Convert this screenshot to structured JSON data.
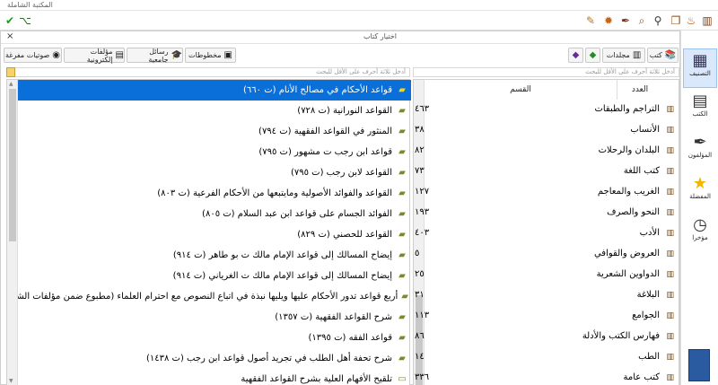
{
  "window": {
    "title": "المكتبة الشاملة",
    "toolbar_icons": [
      "books-icon",
      "book-open-icon",
      "fire-icon",
      "search-icon",
      "search-doc-icon",
      "quill-icon",
      "gear-icon",
      "edit-icon"
    ],
    "left_icons": [
      "check-icon",
      "tree-icon"
    ]
  },
  "subwindow": {
    "title": "اختيار كتاب",
    "close": "×"
  },
  "tabs": {
    "books": "كتب",
    "volumes": "مجلدات",
    "manuscripts": "مخطوطات",
    "theses": "رسائل جامعية",
    "ebooks": "مؤلفات إلكترونية",
    "audio": "صوتيات مفرغة"
  },
  "filters": {
    "books_placeholder": "أدخل ثلاثة أحرف على الأقل للبحث",
    "categories_placeholder": "أدخل ثلاثة أحرف على الأقل للبحث"
  },
  "columns": {
    "category": "القسم",
    "count": "العدد"
  },
  "books": [
    "قواعد الأحكام في مصالح الأنام (ت ٦٦٠)",
    "القواعد النورانية (ت ٧٢٨)",
    "المنثور في القواعد الفقهية (ت ٧٩٤)",
    "قواعد ابن رجب ت مشهور (ت ٧٩٥)",
    "القواعد لابن رجب (ت ٧٩٥)",
    "القواعد والفوائد الأصولية ومايتبعها من الأحكام الفرعية (ت ٨٠٣)",
    "الفوائد الجسام على قواعد ابن عبد السلام (ت ٨٠٥)",
    "القواعد للحصني (ت ٨٢٩)",
    "إيضاح المسالك إلى قواعد الإمام مالك ت بو طاهر (ت ٩١٤)",
    "إيضاح المسالك إلى قواعد الإمام مالك ت الغرياني (ت ٩١٤)",
    "أربع قواعد تدور الأحكام عليها ويليها نبذة في اتباع النصوص مع احترام العلماء (مطبوع ضمن مؤلفات الشيخ محمد بن...",
    "شرح القواعد الفقهية (ت ١٣٥٧)",
    "قواعد الفقه (ت ١٣٩٥)",
    "شرح تحفة أهل الطلب في تجريد أصول قواعد ابن رجب (ت ١٤٣٨)",
    "تلقيح الأفهام العلية بشرح القواعد الفقهية"
  ],
  "categories": [
    {
      "name": "التراجم والطبقات",
      "count": "٤٦٣"
    },
    {
      "name": "الأنساب",
      "count": "٣٨"
    },
    {
      "name": "البلدان والرحلات",
      "count": "٨٢"
    },
    {
      "name": "كتب اللغة",
      "count": "٧٣"
    },
    {
      "name": "الغريب والمعاجم",
      "count": "١٢٧"
    },
    {
      "name": "النحو والصرف",
      "count": "١٩٣"
    },
    {
      "name": "الأدب",
      "count": "٤٠٣"
    },
    {
      "name": "العروض والقوافي",
      "count": "٥"
    },
    {
      "name": "الدواوين الشعرية",
      "count": "٢٥"
    },
    {
      "name": "البلاغة",
      "count": "٣١"
    },
    {
      "name": "الجوامع",
      "count": "١١٣"
    },
    {
      "name": "فهارس الكتب والأدلة",
      "count": "٨٦"
    },
    {
      "name": "الطب",
      "count": "١٤"
    },
    {
      "name": "كتب عامة",
      "count": "٣٣٦"
    }
  ],
  "sidebar": {
    "classification": "التصنيف",
    "books": "الكتب",
    "authors": "المؤلفون",
    "favorites": "المفضلة",
    "recent": "مؤخرا"
  }
}
